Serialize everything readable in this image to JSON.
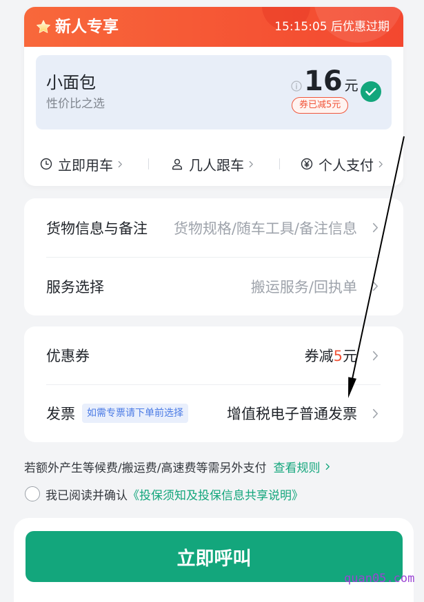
{
  "promo_card": {
    "title": "新人专享",
    "countdown": "15:15:05 后优惠过期",
    "vehicle": {
      "name": "小面包",
      "tagline": "性价比之选",
      "price": "16",
      "price_unit": "元",
      "coupon_badge": "券已减5元",
      "selected": true
    },
    "options": [
      {
        "icon": "clock-icon",
        "label": "立即用车"
      },
      {
        "icon": "person-icon",
        "label": "几人跟车"
      },
      {
        "icon": "yen-icon",
        "label": "个人支付"
      }
    ]
  },
  "order_details": {
    "rows": [
      {
        "label": "货物信息与备注",
        "value": "货物规格/随车工具/备注信息",
        "is_placeholder": true
      },
      {
        "label": "服务选择",
        "value": "搬运服务/回执单",
        "is_placeholder": true
      }
    ]
  },
  "billing": {
    "coupon": {
      "label": "优惠券",
      "value_prefix": "券减",
      "amount": "5",
      "value_suffix": "元"
    },
    "invoice": {
      "label": "发票",
      "hint": "如需专票请下单前选择",
      "value": "增值税电子普通发票"
    }
  },
  "notice": {
    "text": "若额外产生等候费/搬运费/高速费等需另外支付",
    "link_label": "查看规则"
  },
  "agreement": {
    "checked": false,
    "text": "我已阅读并确认",
    "link_label": "《投保须知及投保信息共享说明》"
  },
  "call_button": {
    "label": "立即呼叫"
  },
  "watermark": "quan05.com",
  "colors": {
    "brand_green": "#13a67c",
    "promo_gradient_start": "#f8683b",
    "promo_gradient_end": "#f3472f",
    "discount_red": "#f1553a",
    "hint_blue": "#4b7be5",
    "page_background": "#f3f4f6"
  }
}
